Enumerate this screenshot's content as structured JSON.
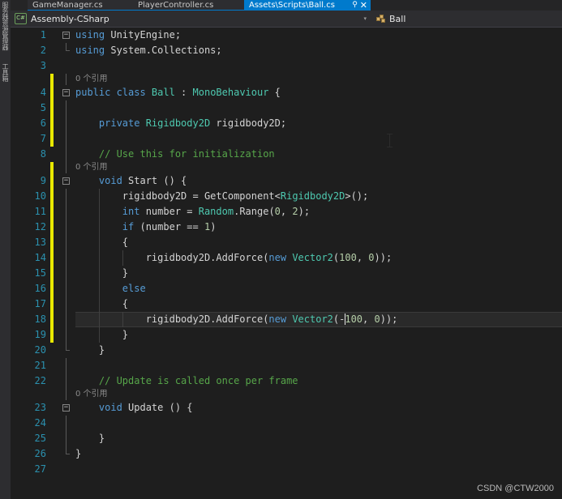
{
  "window": {
    "background": "#1e1e1e",
    "accent": "#007acc"
  },
  "left_strip": {
    "items": [
      {
        "label": "服务器资源管理器",
        "name": "server-explorer"
      },
      {
        "label": "工具箱",
        "name": "toolbox"
      }
    ]
  },
  "tabs": [
    {
      "label": "GameManager.cs",
      "active": false
    },
    {
      "label": "PlayerController.cs",
      "active": false
    },
    {
      "label": "Assets\\Scripts\\Ball.cs",
      "active": true,
      "pin": "⚲",
      "close": "✕"
    }
  ],
  "navbar": {
    "project_icon": "C#",
    "project": "Assembly-CSharp",
    "dropdown_caret": "▾",
    "member_icon": "class-icon",
    "member": "Ball"
  },
  "watermark": "CSDN @CTW2000",
  "editor": {
    "lines": [
      {
        "n": "1",
        "fold": "−",
        "change": "none",
        "current": false,
        "tokens": [
          {
            "t": "using ",
            "c": "kw"
          },
          {
            "t": "UnityEngine;",
            "c": "pl"
          }
        ]
      },
      {
        "n": "2",
        "fold": "endline",
        "change": "none",
        "current": false,
        "tokens": [
          {
            "t": "using ",
            "c": "kw"
          },
          {
            "t": "System.Collections;",
            "c": "pl"
          }
        ]
      },
      {
        "n": "3",
        "fold": "none",
        "change": "none",
        "current": false,
        "tokens": []
      },
      {
        "n": "",
        "codelens": "0 个引用",
        "change": "yellow",
        "current": false
      },
      {
        "n": "4",
        "fold": "−",
        "change": "yellow",
        "current": false,
        "tokens": [
          {
            "t": "public class ",
            "c": "kw"
          },
          {
            "t": "Ball",
            "c": "type"
          },
          {
            "t": " : ",
            "c": "pl"
          },
          {
            "t": "MonoBehaviour",
            "c": "type"
          },
          {
            "t": " {",
            "c": "pl"
          }
        ]
      },
      {
        "n": "5",
        "fold": "line",
        "change": "yellow",
        "current": false,
        "tokens": []
      },
      {
        "n": "6",
        "fold": "line",
        "change": "yellow",
        "current": false,
        "tokens": [
          {
            "t": "    private ",
            "c": "kw"
          },
          {
            "t": "Rigidbody2D",
            "c": "type"
          },
          {
            "t": " rigidbody2D;",
            "c": "pl"
          }
        ]
      },
      {
        "n": "7",
        "fold": "line",
        "change": "yellow",
        "current": false,
        "tokens": []
      },
      {
        "n": "8",
        "fold": "line",
        "change": "none",
        "current": false,
        "tokens": [
          {
            "t": "    // Use this for initialization",
            "c": "cmt"
          }
        ]
      },
      {
        "n": "",
        "codelens": "0 个引用",
        "change": "yellow",
        "current": false
      },
      {
        "n": "9",
        "fold": "−",
        "change": "yellow",
        "current": false,
        "tokens": [
          {
            "t": "    void ",
            "c": "kw"
          },
          {
            "t": "Start",
            "c": "pl"
          },
          {
            "t": " () {",
            "c": "pl"
          }
        ]
      },
      {
        "n": "10",
        "fold": "line",
        "change": "yellow",
        "current": false,
        "tokens": [
          {
            "t": "        rigidbody2D = GetComponent<",
            "c": "pl"
          },
          {
            "t": "Rigidbody2D",
            "c": "type"
          },
          {
            "t": ">();",
            "c": "pl"
          }
        ]
      },
      {
        "n": "11",
        "fold": "line",
        "change": "yellow",
        "current": false,
        "tokens": [
          {
            "t": "        int ",
            "c": "kw"
          },
          {
            "t": "number = ",
            "c": "pl"
          },
          {
            "t": "Random",
            "c": "type"
          },
          {
            "t": ".Range(",
            "c": "pl"
          },
          {
            "t": "0",
            "c": "num"
          },
          {
            "t": ", ",
            "c": "pl"
          },
          {
            "t": "2",
            "c": "num"
          },
          {
            "t": ");",
            "c": "pl"
          }
        ]
      },
      {
        "n": "12",
        "fold": "line",
        "change": "yellow",
        "current": false,
        "tokens": [
          {
            "t": "        if ",
            "c": "kw"
          },
          {
            "t": "(number == ",
            "c": "pl"
          },
          {
            "t": "1",
            "c": "num"
          },
          {
            "t": ")",
            "c": "pl"
          }
        ]
      },
      {
        "n": "13",
        "fold": "line",
        "change": "yellow",
        "current": false,
        "tokens": [
          {
            "t": "        {",
            "c": "pl"
          }
        ]
      },
      {
        "n": "14",
        "fold": "line",
        "change": "yellow",
        "current": false,
        "tokens": [
          {
            "t": "            rigidbody2D.AddForce(",
            "c": "pl"
          },
          {
            "t": "new ",
            "c": "kw"
          },
          {
            "t": "Vector2",
            "c": "type"
          },
          {
            "t": "(",
            "c": "pl"
          },
          {
            "t": "100",
            "c": "num"
          },
          {
            "t": ", ",
            "c": "pl"
          },
          {
            "t": "0",
            "c": "num"
          },
          {
            "t": "));",
            "c": "pl"
          }
        ]
      },
      {
        "n": "15",
        "fold": "line",
        "change": "yellow",
        "current": false,
        "tokens": [
          {
            "t": "        }",
            "c": "pl"
          }
        ]
      },
      {
        "n": "16",
        "fold": "line",
        "change": "yellow",
        "current": false,
        "tokens": [
          {
            "t": "        else",
            "c": "kw"
          }
        ]
      },
      {
        "n": "17",
        "fold": "line",
        "change": "yellow",
        "current": false,
        "tokens": [
          {
            "t": "        {",
            "c": "pl"
          }
        ]
      },
      {
        "n": "18",
        "fold": "line",
        "change": "yellow",
        "current": true,
        "caret_after": "            rigidbody2D.AddForce(new Vector2(-",
        "tokens": [
          {
            "t": "            rigidbody2D.AddForce(",
            "c": "pl"
          },
          {
            "t": "new ",
            "c": "kw"
          },
          {
            "t": "Vector2",
            "c": "type"
          },
          {
            "t": "(-",
            "c": "pl"
          },
          {
            "t": "caret",
            "c": "caret"
          },
          {
            "t": "100",
            "c": "num"
          },
          {
            "t": ", ",
            "c": "pl"
          },
          {
            "t": "0",
            "c": "num"
          },
          {
            "t": "));",
            "c": "pl"
          }
        ]
      },
      {
        "n": "19",
        "fold": "line",
        "change": "yellow",
        "current": false,
        "tokens": [
          {
            "t": "        }",
            "c": "pl"
          }
        ]
      },
      {
        "n": "20",
        "fold": "endline",
        "change": "none",
        "current": false,
        "tokens": [
          {
            "t": "    }",
            "c": "pl"
          }
        ]
      },
      {
        "n": "21",
        "fold": "line",
        "change": "none",
        "current": false,
        "tokens": []
      },
      {
        "n": "22",
        "fold": "line",
        "change": "none",
        "current": false,
        "tokens": [
          {
            "t": "    // Update is called once per frame",
            "c": "cmt"
          }
        ]
      },
      {
        "n": "",
        "codelens": "0 个引用",
        "change": "none",
        "current": false
      },
      {
        "n": "23",
        "fold": "−",
        "change": "none",
        "current": false,
        "tokens": [
          {
            "t": "    void ",
            "c": "kw"
          },
          {
            "t": "Update",
            "c": "pl"
          },
          {
            "t": " () {",
            "c": "pl"
          }
        ]
      },
      {
        "n": "24",
        "fold": "line",
        "change": "none",
        "current": false,
        "tokens": []
      },
      {
        "n": "25",
        "fold": "line",
        "change": "none",
        "current": false,
        "tokens": [
          {
            "t": "    }",
            "c": "pl"
          }
        ]
      },
      {
        "n": "26",
        "fold": "endline",
        "change": "none",
        "current": false,
        "tokens": [
          {
            "t": "}",
            "c": "pl"
          }
        ]
      },
      {
        "n": "27",
        "fold": "none",
        "change": "none",
        "current": false,
        "tokens": []
      }
    ]
  }
}
